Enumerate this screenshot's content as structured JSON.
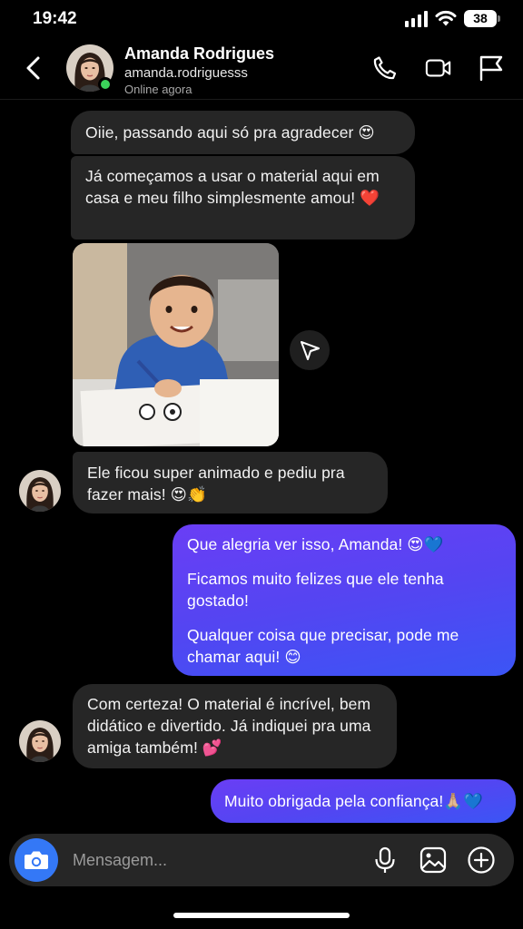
{
  "status_bar": {
    "time": "19:42",
    "battery": "38"
  },
  "header": {
    "name": "Amanda Rodrigues",
    "username": "amanda.rodriguesss",
    "status": "Online agora"
  },
  "messages": [
    {
      "from": "them",
      "text": "Oiie, passando aqui só pra agradecer 😍"
    },
    {
      "from": "them",
      "text": "Já começamos a usar o material aqui em casa e meu filho simplesmente amou! ❤️"
    },
    {
      "from": "them",
      "type": "photo"
    },
    {
      "from": "them",
      "text": "Ele ficou super animado e pediu pra fazer mais! 😍👏"
    },
    {
      "from": "me",
      "paragraphs": [
        "Que alegria ver isso, Amanda! 😍💙",
        "Ficamos muito felizes que ele tenha gostado!",
        "Qualquer coisa que precisar, pode me chamar aqui! 😊"
      ]
    },
    {
      "from": "them",
      "text": "Com certeza! O material é incrível, bem didático e divertido. Já indiquei pra uma amiga também! 💕"
    },
    {
      "from": "me",
      "text": "Muito obrigada pela confiança!🙏🏼💙"
    }
  ],
  "composer": {
    "placeholder": "Mensagem..."
  },
  "icons": {
    "back": "chevron-left-icon",
    "call": "phone-icon",
    "video": "video-camera-icon",
    "report": "flag-icon",
    "share": "send-icon",
    "camera": "camera-icon",
    "mic": "microphone-icon",
    "gallery": "image-icon",
    "add": "plus-circle-icon"
  },
  "colors": {
    "online": "#3bd15a",
    "camera_button": "#3478f6",
    "outgoing_start": "#6a3ef5",
    "outgoing_end": "#3b55f5",
    "incoming": "#262626"
  }
}
